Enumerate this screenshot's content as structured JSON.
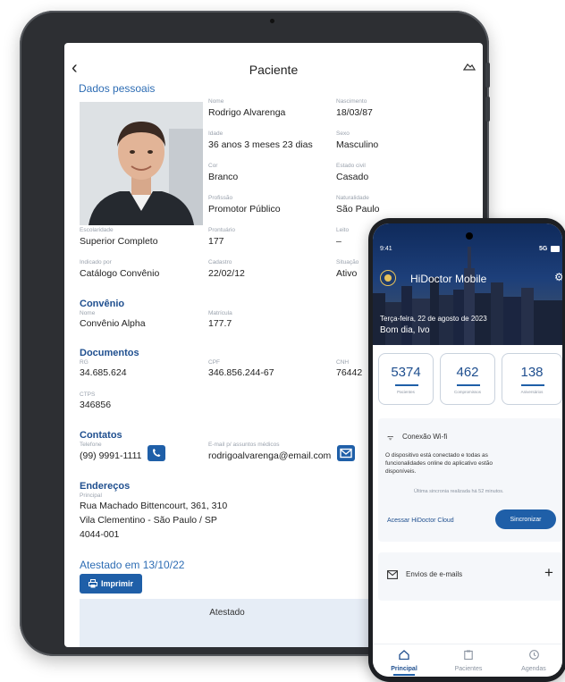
{
  "tablet": {
    "header": {
      "back_icon": "chevron-left-icon",
      "title": "Paciente",
      "cloud_icon": "cloud-icon"
    },
    "personal": {
      "section_title": "Dados pessoais",
      "fields": {
        "nome": {
          "label": "Nome",
          "value": "Rodrigo Alvarenga"
        },
        "nascimento": {
          "label": "Nascimento",
          "value": "18/03/87"
        },
        "idade": {
          "label": "Idade",
          "value": "36 anos 3 meses 23 dias"
        },
        "sexo": {
          "label": "Sexo",
          "value": "Masculino"
        },
        "cor": {
          "label": "Cor",
          "value": "Branco"
        },
        "estado_civil": {
          "label": "Estado civil",
          "value": "Casado"
        },
        "profissao": {
          "label": "Profissão",
          "value": "Promotor Público"
        },
        "naturalidade": {
          "label": "Naturalidade",
          "value": "São Paulo"
        },
        "escolaridade": {
          "label": "Escolaridade",
          "value": "Superior Completo"
        },
        "prontuario": {
          "label": "Prontuário",
          "value": "177"
        },
        "leito": {
          "label": "Leito",
          "value": "–"
        },
        "indicado_por": {
          "label": "Indicado por",
          "value": "Catálogo Convênio"
        },
        "cadastro": {
          "label": "Cadastro",
          "value": "22/02/12"
        },
        "situacao": {
          "label": "Situação",
          "value": "Ativo"
        }
      }
    },
    "convenio": {
      "title": "Convênio",
      "nome": {
        "label": "Nome",
        "value": "Convênio Alpha"
      },
      "matricula": {
        "label": "Matrícula",
        "value": "177.7"
      }
    },
    "documentos": {
      "title": "Documentos",
      "rg": {
        "label": "RG",
        "value": "34.685.624"
      },
      "cpf": {
        "label": "CPF",
        "value": "346.856.244-67"
      },
      "cnh": {
        "label": "CNH",
        "value": "76442"
      },
      "ctps": {
        "label": "CTPS",
        "value": "346856"
      }
    },
    "contatos": {
      "title": "Contatos",
      "telefone": {
        "label": "Telefone",
        "value": "(99) 9991-1111"
      },
      "email": {
        "label": "E-mail p/ assuntos médicos",
        "value": "rodrigoalvarenga@email.com"
      }
    },
    "enderecos": {
      "title": "Endereços",
      "label": "Principal",
      "line1": "Rua Machado Bittencourt, 361, 310",
      "line2": "Vila Clementino - São Paulo / SP",
      "line3": "4044-001"
    },
    "atestado": {
      "title": "Atestado em 13/10/22",
      "print_label": "Imprimir",
      "box_title": "Atestado"
    }
  },
  "phone": {
    "status": {
      "time": "9:41",
      "right": "5G"
    },
    "app_title": "HiDoctor Mobile",
    "date": "Terça-feira, 22 de agosto de 2023",
    "greeting": "Bom dia, Ivo",
    "stats": [
      {
        "value": "5374",
        "label": "Pacientes"
      },
      {
        "value": "462",
        "label": "Compromissos"
      },
      {
        "value": "138",
        "label": "Aniversários"
      }
    ],
    "wifi": {
      "title": "Conexão Wi-fi",
      "message_1": "O dispositivo está conectado e todas as",
      "message_2": "funcionalidades online do aplicativo estão",
      "message_3": "disponíveis.",
      "last_sync": "Última sincronia realizada há 52 minutos.",
      "cloud_link": "Acessar HiDoctor Cloud",
      "sync_label": "Sincronizar"
    },
    "emails": {
      "title": "Envios de e-mails",
      "add": "+"
    },
    "nav": [
      {
        "label": "Principal",
        "icon": "home-icon"
      },
      {
        "label": "Pacientes",
        "icon": "clipboard-icon"
      },
      {
        "label": "Agendas",
        "icon": "clock-icon"
      }
    ],
    "colors": {
      "primary": "#1f5fa8",
      "title": "#1f4f8f"
    }
  }
}
